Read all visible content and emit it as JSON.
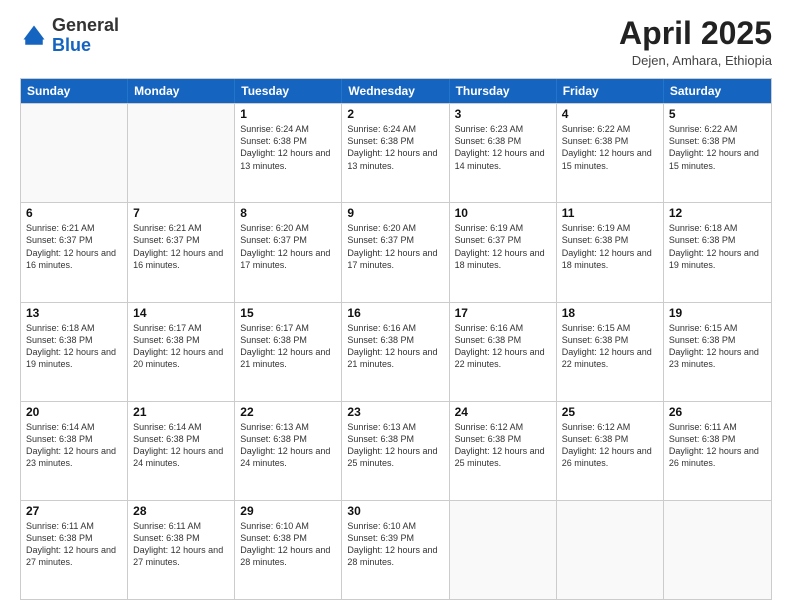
{
  "logo": {
    "general": "General",
    "blue": "Blue"
  },
  "header": {
    "month": "April 2025",
    "location": "Dejen, Amhara, Ethiopia"
  },
  "days": [
    "Sunday",
    "Monday",
    "Tuesday",
    "Wednesday",
    "Thursday",
    "Friday",
    "Saturday"
  ],
  "weeks": [
    [
      {
        "day": "",
        "info": ""
      },
      {
        "day": "",
        "info": ""
      },
      {
        "day": "1",
        "info": "Sunrise: 6:24 AM\nSunset: 6:38 PM\nDaylight: 12 hours and 13 minutes."
      },
      {
        "day": "2",
        "info": "Sunrise: 6:24 AM\nSunset: 6:38 PM\nDaylight: 12 hours and 13 minutes."
      },
      {
        "day": "3",
        "info": "Sunrise: 6:23 AM\nSunset: 6:38 PM\nDaylight: 12 hours and 14 minutes."
      },
      {
        "day": "4",
        "info": "Sunrise: 6:22 AM\nSunset: 6:38 PM\nDaylight: 12 hours and 15 minutes."
      },
      {
        "day": "5",
        "info": "Sunrise: 6:22 AM\nSunset: 6:38 PM\nDaylight: 12 hours and 15 minutes."
      }
    ],
    [
      {
        "day": "6",
        "info": "Sunrise: 6:21 AM\nSunset: 6:37 PM\nDaylight: 12 hours and 16 minutes."
      },
      {
        "day": "7",
        "info": "Sunrise: 6:21 AM\nSunset: 6:37 PM\nDaylight: 12 hours and 16 minutes."
      },
      {
        "day": "8",
        "info": "Sunrise: 6:20 AM\nSunset: 6:37 PM\nDaylight: 12 hours and 17 minutes."
      },
      {
        "day": "9",
        "info": "Sunrise: 6:20 AM\nSunset: 6:37 PM\nDaylight: 12 hours and 17 minutes."
      },
      {
        "day": "10",
        "info": "Sunrise: 6:19 AM\nSunset: 6:37 PM\nDaylight: 12 hours and 18 minutes."
      },
      {
        "day": "11",
        "info": "Sunrise: 6:19 AM\nSunset: 6:38 PM\nDaylight: 12 hours and 18 minutes."
      },
      {
        "day": "12",
        "info": "Sunrise: 6:18 AM\nSunset: 6:38 PM\nDaylight: 12 hours and 19 minutes."
      }
    ],
    [
      {
        "day": "13",
        "info": "Sunrise: 6:18 AM\nSunset: 6:38 PM\nDaylight: 12 hours and 19 minutes."
      },
      {
        "day": "14",
        "info": "Sunrise: 6:17 AM\nSunset: 6:38 PM\nDaylight: 12 hours and 20 minutes."
      },
      {
        "day": "15",
        "info": "Sunrise: 6:17 AM\nSunset: 6:38 PM\nDaylight: 12 hours and 21 minutes."
      },
      {
        "day": "16",
        "info": "Sunrise: 6:16 AM\nSunset: 6:38 PM\nDaylight: 12 hours and 21 minutes."
      },
      {
        "day": "17",
        "info": "Sunrise: 6:16 AM\nSunset: 6:38 PM\nDaylight: 12 hours and 22 minutes."
      },
      {
        "day": "18",
        "info": "Sunrise: 6:15 AM\nSunset: 6:38 PM\nDaylight: 12 hours and 22 minutes."
      },
      {
        "day": "19",
        "info": "Sunrise: 6:15 AM\nSunset: 6:38 PM\nDaylight: 12 hours and 23 minutes."
      }
    ],
    [
      {
        "day": "20",
        "info": "Sunrise: 6:14 AM\nSunset: 6:38 PM\nDaylight: 12 hours and 23 minutes."
      },
      {
        "day": "21",
        "info": "Sunrise: 6:14 AM\nSunset: 6:38 PM\nDaylight: 12 hours and 24 minutes."
      },
      {
        "day": "22",
        "info": "Sunrise: 6:13 AM\nSunset: 6:38 PM\nDaylight: 12 hours and 24 minutes."
      },
      {
        "day": "23",
        "info": "Sunrise: 6:13 AM\nSunset: 6:38 PM\nDaylight: 12 hours and 25 minutes."
      },
      {
        "day": "24",
        "info": "Sunrise: 6:12 AM\nSunset: 6:38 PM\nDaylight: 12 hours and 25 minutes."
      },
      {
        "day": "25",
        "info": "Sunrise: 6:12 AM\nSunset: 6:38 PM\nDaylight: 12 hours and 26 minutes."
      },
      {
        "day": "26",
        "info": "Sunrise: 6:11 AM\nSunset: 6:38 PM\nDaylight: 12 hours and 26 minutes."
      }
    ],
    [
      {
        "day": "27",
        "info": "Sunrise: 6:11 AM\nSunset: 6:38 PM\nDaylight: 12 hours and 27 minutes."
      },
      {
        "day": "28",
        "info": "Sunrise: 6:11 AM\nSunset: 6:38 PM\nDaylight: 12 hours and 27 minutes."
      },
      {
        "day": "29",
        "info": "Sunrise: 6:10 AM\nSunset: 6:38 PM\nDaylight: 12 hours and 28 minutes."
      },
      {
        "day": "30",
        "info": "Sunrise: 6:10 AM\nSunset: 6:39 PM\nDaylight: 12 hours and 28 minutes."
      },
      {
        "day": "",
        "info": ""
      },
      {
        "day": "",
        "info": ""
      },
      {
        "day": "",
        "info": ""
      }
    ]
  ]
}
